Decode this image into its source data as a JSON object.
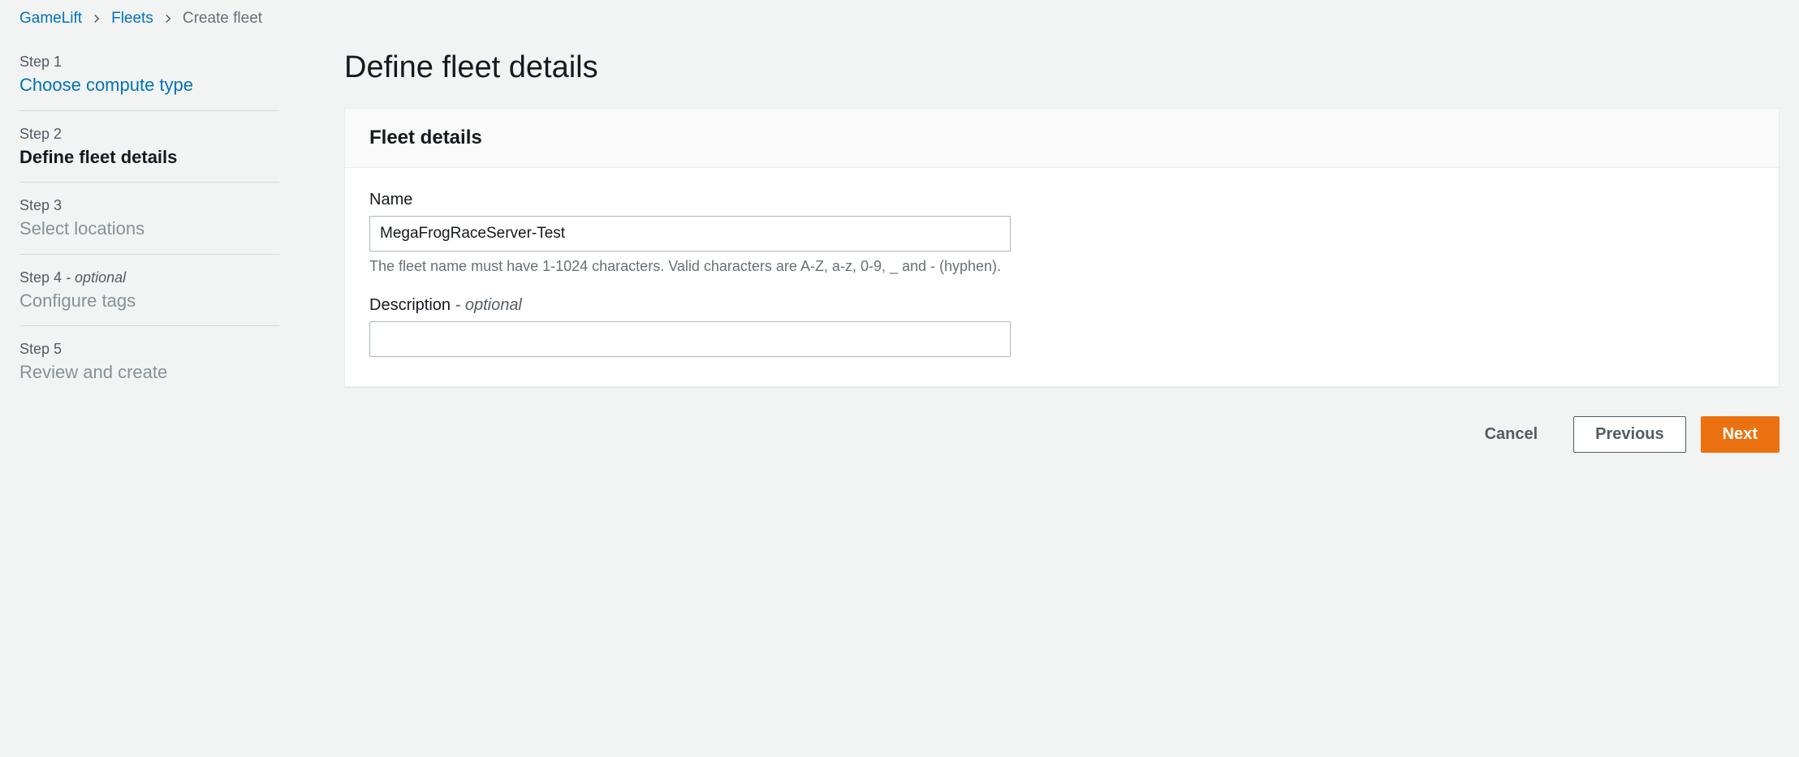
{
  "breadcrumb": {
    "items": [
      {
        "label": "GameLift"
      },
      {
        "label": "Fleets"
      }
    ],
    "current": "Create fleet"
  },
  "steps": [
    {
      "num": "Step 1",
      "title": "Choose compute type",
      "optional": "",
      "state": "link"
    },
    {
      "num": "Step 2",
      "title": "Define fleet details",
      "optional": "",
      "state": "active"
    },
    {
      "num": "Step 3",
      "title": "Select locations",
      "optional": "",
      "state": "disabled"
    },
    {
      "num": "Step 4",
      "title": "Configure tags",
      "optional": " - optional",
      "state": "disabled"
    },
    {
      "num": "Step 5",
      "title": "Review and create",
      "optional": "",
      "state": "disabled"
    }
  ],
  "page": {
    "title": "Define fleet details"
  },
  "panel": {
    "title": "Fleet details",
    "name": {
      "label": "Name",
      "value": "MegaFrogRaceServer-Test",
      "hint": "The fleet name must have 1-1024 characters. Valid characters are A-Z, a-z, 0-9, _ and - (hyphen)."
    },
    "description": {
      "label": "Description",
      "optional": " - optional",
      "value": ""
    }
  },
  "buttons": {
    "cancel": "Cancel",
    "previous": "Previous",
    "next": "Next"
  }
}
